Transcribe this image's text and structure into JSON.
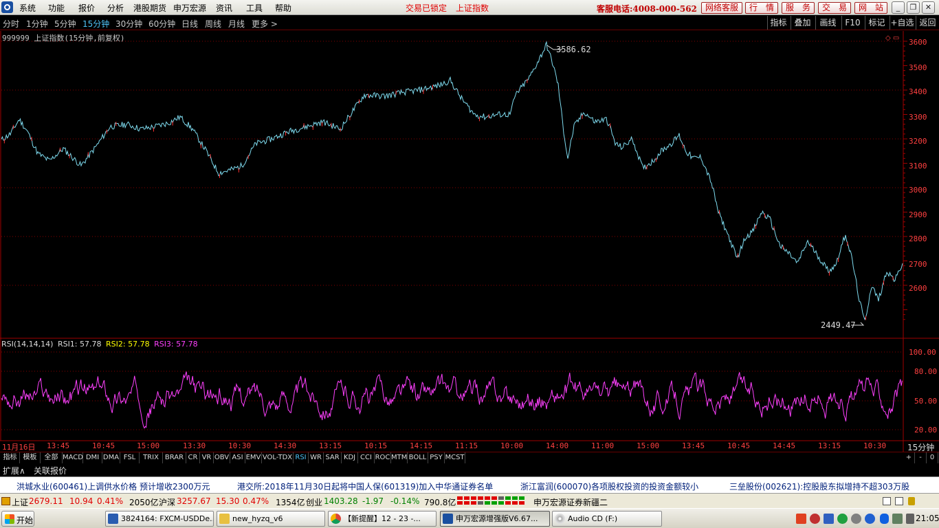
{
  "menu": {
    "items": [
      "系统",
      "功能",
      "报价",
      "分析",
      "港股期货",
      "申万宏源",
      "资讯",
      "工具",
      "帮助"
    ],
    "trade_status": "交易已锁定",
    "index_name": "上证指数",
    "service_phone": "客服电话:4008-000-562",
    "right_buttons": [
      "网络客服",
      "行　情",
      "服　务",
      "交　易",
      "网　站"
    ],
    "window_controls": [
      "_",
      "❐",
      "✕"
    ]
  },
  "periods": {
    "items": [
      "分时",
      "1分钟",
      "5分钟",
      "15分钟",
      "30分钟",
      "60分钟",
      "日线",
      "周线",
      "月线",
      "更多 >"
    ],
    "active_index": 3
  },
  "toolbar": [
    "指标",
    "叠加",
    "画线",
    "F10",
    "标记",
    "+自选",
    "返回"
  ],
  "main_chart": {
    "title": "999999 上证指数(15分钟,前复权)",
    "high_label": "3586.62",
    "low_label": "2449.47",
    "y_ticks": [
      "3600",
      "3500",
      "3400",
      "3300",
      "3200",
      "3100",
      "3000",
      "2900",
      "2800",
      "2700",
      "2600"
    ],
    "line_color": "#7fdcf0"
  },
  "rsi": {
    "name": "RSI(14,14,14)",
    "rsi1": "RSI1: 57.78",
    "rsi2": "RSI2: 57.78",
    "rsi3": "RSI3: 57.78",
    "y_ticks": [
      "100.00",
      "80.00",
      "50.00",
      "20.00"
    ],
    "line_color": "#ff40ff"
  },
  "x_axis": {
    "labels": [
      "11月16日",
      "13:45",
      "10:45",
      "15:00",
      "13:30",
      "10:30",
      "14:30",
      "13:15",
      "10:15",
      "14:15",
      "11:15",
      "10:00",
      "14:00",
      "11:00",
      "15:00",
      "13:45",
      "10:45",
      "14:45",
      "13:15",
      "10:30"
    ],
    "period_label": "15分钟"
  },
  "indicator_tabs": {
    "items": [
      "指标",
      "模板",
      "全部",
      "MACD",
      "DMI",
      "DMA",
      "FSL",
      "TRIX",
      "BRAR",
      "CR",
      "VR",
      "OBV",
      "ASI",
      "EMV",
      "VOL-TDX",
      "RSI",
      "WR",
      "SAR",
      "KDJ",
      "CCI",
      "ROC",
      "MTM",
      "BOLL",
      "PSY",
      "MCST"
    ],
    "active": "RSI",
    "right_controls": [
      "+",
      "-",
      "0"
    ]
  },
  "extension": {
    "expand": "扩展∧",
    "related": "关联报价"
  },
  "news": [
    "洪城水业(600461)上调供水价格 预计增收2300万元",
    "港交所:2018年11月30日起将中国人保(601319)加入中华通证券名单",
    "浙江富润(600070)各项股权投资的投资金额较小",
    "三垒股份(002621):控股股东拟增持不超303万股"
  ],
  "quotes": {
    "sh_name": "上证",
    "sh_price": "2679.11",
    "sh_change": "10.94",
    "sh_pct": "0.41%",
    "sh_amount": "2050亿",
    "hs_name": "沪深",
    "hs_price": "3257.67",
    "hs_change": "15.30",
    "hs_pct": "0.47%",
    "hs_amount": "1354亿",
    "cy_name": "创业",
    "cy_price": "1403.28",
    "cy_change": "-1.97",
    "cy_pct": "-0.14%",
    "cy_amount": "790.8亿",
    "server": "申万宏源证券新疆二"
  },
  "taskbar": {
    "start": "开始",
    "tasks": [
      "3824164: FXCM-USDDe...",
      "new_hyzq_v6",
      "【新提醒】12 - 23 -...",
      "申万宏源增强版V6.67...",
      "Audio CD (F:)"
    ],
    "active_index": 3,
    "clock": "21:05"
  }
}
